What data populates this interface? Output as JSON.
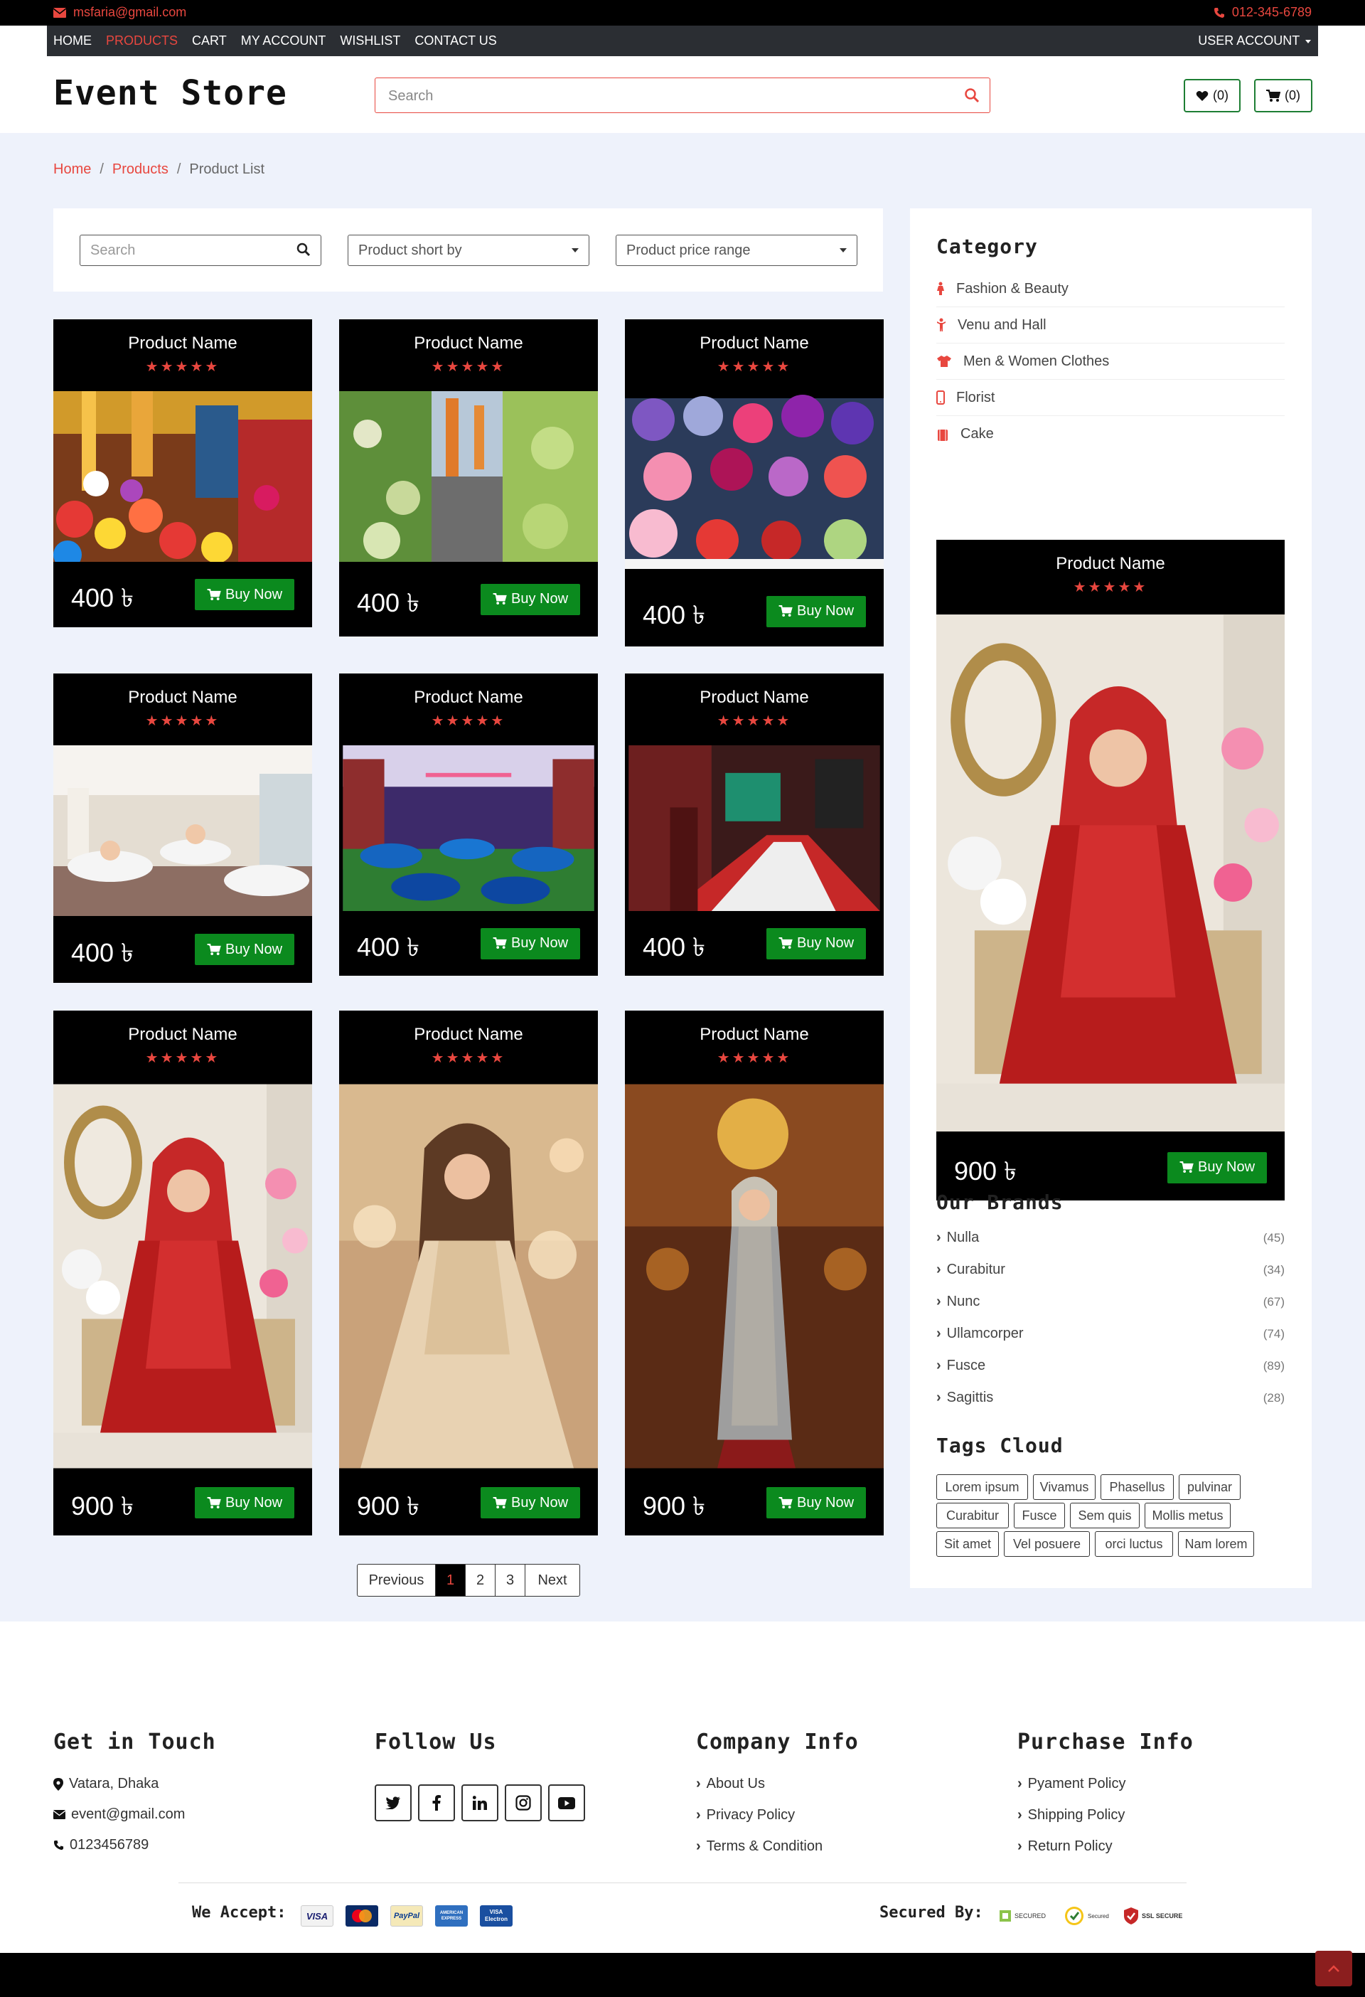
{
  "topbar": {
    "email": "msfaria@gmail.com",
    "phone": "012-345-6789"
  },
  "nav": {
    "items": [
      "HOME",
      "PRODUCTS",
      "CART",
      "MY ACCOUNT",
      "WISHLIST",
      "CONTACT US"
    ],
    "active": "PRODUCTS",
    "account": "USER ACCOUNT"
  },
  "header": {
    "logo": "Event Store",
    "search_placeholder": "Search",
    "wishlist_count": "(0)",
    "cart_count": "(0)"
  },
  "breadcrumb": {
    "home": "Home",
    "products": "Products",
    "current": "Product List"
  },
  "filters": {
    "search_placeholder": "Search",
    "sort": "Product short by",
    "price": "Product price range"
  },
  "products": [
    {
      "name": "Product Name",
      "price": "400 ৳",
      "buy": "Buy Now",
      "rating": 5
    },
    {
      "name": "Product Name",
      "price": "400 ৳",
      "buy": "Buy Now",
      "rating": 5
    },
    {
      "name": "Product Name",
      "price": "400 ৳",
      "buy": "Buy Now",
      "rating": 5
    },
    {
      "name": "Product Name",
      "price": "400 ৳",
      "buy": "Buy Now",
      "rating": 5
    },
    {
      "name": "Product Name",
      "price": "400 ৳",
      "buy": "Buy Now",
      "rating": 5
    },
    {
      "name": "Product Name",
      "price": "400 ৳",
      "buy": "Buy Now",
      "rating": 5
    },
    {
      "name": "Product Name",
      "price": "900 ৳",
      "buy": "Buy Now",
      "rating": 5
    },
    {
      "name": "Product Name",
      "price": "900 ৳",
      "buy": "Buy Now",
      "rating": 5
    },
    {
      "name": "Product Name",
      "price": "900 ৳",
      "buy": "Buy Now",
      "rating": 5
    }
  ],
  "pagination": {
    "prev": "Previous",
    "pages": [
      "1",
      "2",
      "3"
    ],
    "current": "1",
    "next": "Next"
  },
  "sidebar": {
    "category_title": "Category",
    "categories": [
      {
        "label": "Fashion & Beauty",
        "icon": "female-icon"
      },
      {
        "label": "Venu and Hall",
        "icon": "child-icon"
      },
      {
        "label": "Men & Women Clothes",
        "icon": "shirt-icon"
      },
      {
        "label": "Florist",
        "icon": "mobile-icon"
      },
      {
        "label": "Cake",
        "icon": "cake-icon"
      }
    ],
    "featured": {
      "name": "Product Name",
      "price": "900 ৳",
      "buy": "Buy Now",
      "rating": 5
    },
    "brands_title": "Our Brands",
    "brands": [
      {
        "name": "Nulla",
        "count": "(45)"
      },
      {
        "name": "Curabitur",
        "count": "(34)"
      },
      {
        "name": "Nunc",
        "count": "(67)"
      },
      {
        "name": "Ullamcorper",
        "count": "(74)"
      },
      {
        "name": "Fusce",
        "count": "(89)"
      },
      {
        "name": "Sagittis",
        "count": "(28)"
      }
    ],
    "tags_title": "Tags Cloud",
    "tags": [
      "Lorem ipsum",
      "Vivamus",
      "Phasellus",
      "pulvinar",
      "Curabitur",
      "Fusce",
      "Sem quis",
      "Mollis metus",
      "Sit amet",
      "Vel posuere",
      "orci luctus",
      "Nam lorem"
    ]
  },
  "footer": {
    "touch_title": "Get in Touch",
    "address": "Vatara, Dhaka",
    "email": "event@gmail.com",
    "phone": "0123456789",
    "follow_title": "Follow Us",
    "social": [
      "twitter-icon",
      "facebook-icon",
      "linkedin-icon",
      "instagram-icon",
      "youtube-icon"
    ],
    "company_title": "Company Info",
    "company_links": [
      "About Us",
      "Privacy Policy",
      "Terms & Condition"
    ],
    "purchase_title": "Purchase Info",
    "purchase_links": [
      "Pyament Policy",
      "Shipping Policy",
      "Return Policy"
    ],
    "accept_label": "We Accept:",
    "payment_cards": [
      "VISA",
      "MasterCard",
      "PayPal",
      "AMERICAN EXPRESS",
      "VISA Electron"
    ],
    "secured_label": "Secured By:",
    "seals": [
      "SECURED",
      "Secured",
      "SSL SECURE"
    ]
  },
  "colors": {
    "accent": "#e8473f",
    "buy_green": "#0b8a1e",
    "nav_bg": "#2b2e33",
    "main_bg": "#eef2fb"
  }
}
